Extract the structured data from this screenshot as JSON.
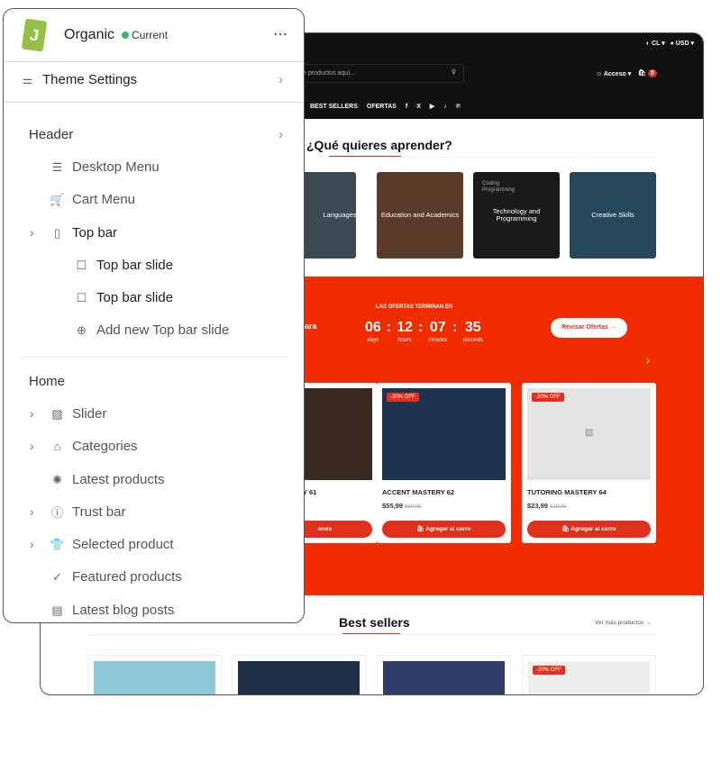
{
  "panel": {
    "theme_name": "Organic",
    "status": "Current",
    "menu_icon": "more-icon",
    "theme_settings": "Theme Settings",
    "header_label": "Header",
    "header_items": [
      "Desktop Menu",
      "Cart Menu",
      "Top bar",
      "Top bar slide",
      "Top bar slide",
      "Add new Top bar slide"
    ],
    "home_label": "Home",
    "home_items": [
      "Slider",
      "Categories",
      "Latest products",
      "Trust bar",
      "Selected product",
      "Featured products",
      "Latest blog posts"
    ]
  },
  "store": {
    "locale": "CL",
    "currency": "USD",
    "search_placeholder": "e productos aquí...",
    "account": "Acceso",
    "cart_count": "0",
    "nav": [
      "BEST SELLERS",
      "OFERTAS"
    ],
    "learn_title": "¿Qué quieres aprender?",
    "categories": [
      "Languages",
      "Education and Academics",
      "Technology and Programming",
      "Creative Skills"
    ],
    "coding_text": "Coding\nProgramming",
    "deals_heading": "LAS OFERTAS TERMINAN EN",
    "deals_left_text": "ara",
    "countdown": [
      {
        "value": "06",
        "unit": "days"
      },
      {
        "value": "12",
        "unit": "hours"
      },
      {
        "value": "07",
        "unit": "minutes"
      },
      {
        "value": "35",
        "unit": "seconds"
      }
    ],
    "deals_button": "Revisar Ofertas →",
    "products": [
      {
        "name": "Y 61",
        "price": "",
        "old": "",
        "button": "ones",
        "badge": ""
      },
      {
        "name": "ACCENT MASTERY 62",
        "price": "$55,99",
        "old": "$69,99",
        "button": "Agregar al carro",
        "badge": "-20% OFF"
      },
      {
        "name": "TUTORING MASTERY 64",
        "price": "$23,99",
        "old": "$29,99",
        "button": "Agregar al carro",
        "badge": "-20% OFF"
      }
    ],
    "best_title": "Best sellers",
    "more_link": "Ver más productos →",
    "best_badge": "-20% OFF",
    "colors": {
      "accent": "#f02c00",
      "dark": "#111111"
    }
  }
}
